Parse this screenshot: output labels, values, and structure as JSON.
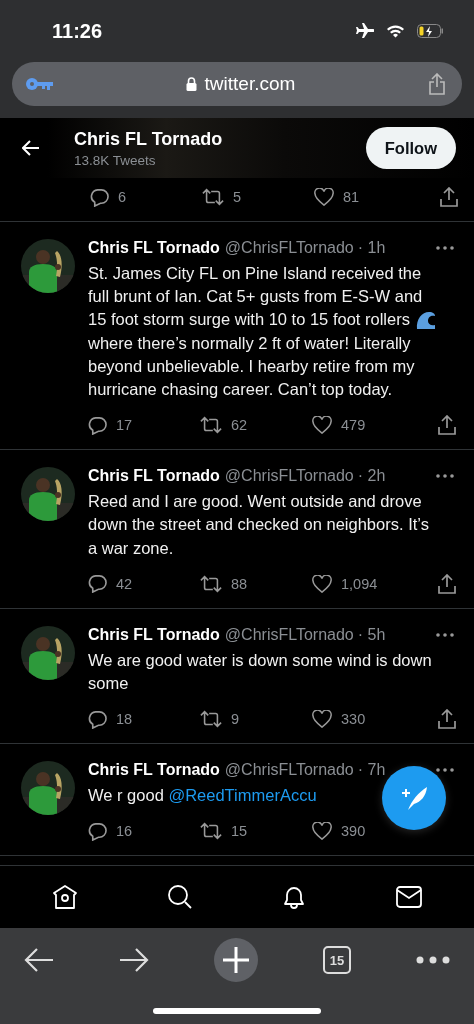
{
  "status_bar": {
    "time": "11:26"
  },
  "address_bar": {
    "url": "twitter.com"
  },
  "profile_header": {
    "name": "Chris FL Tornado",
    "tweet_count": "13.8K Tweets",
    "follow_button": "Follow"
  },
  "previous_tweet": {
    "replies": "6",
    "retweets": "5",
    "likes": "81"
  },
  "tweets": [
    {
      "name": "Chris FL Tornado",
      "handle": "@ChrisFLTornado",
      "time": "· 1h",
      "parts": [
        {
          "kind": "text",
          "text": "St. James City FL on Pine Island received the full brunt of Ian. Cat 5+ gusts from E-S-W and"
        },
        {
          "kind": "text_wave",
          "text": "15 foot storm surge with 10 to 15 foot rollers"
        },
        {
          "kind": "text",
          "text": "where there’s normally 2 ft of water!  Literally beyond unbelievable. I hearby retire from my hurricane chasing career. Can’t top today."
        }
      ],
      "replies": "17",
      "retweets": "62",
      "likes": "479"
    },
    {
      "name": "Chris FL Tornado",
      "handle": "@ChrisFLTornado",
      "time": "· 2h",
      "parts": [
        {
          "kind": "text",
          "text": "Reed and I are good. Went outside and drove down the street and checked on neighbors. It’s a war zone."
        }
      ],
      "replies": "42",
      "retweets": "88",
      "likes": "1,094"
    },
    {
      "name": "Chris FL Tornado",
      "handle": "@ChrisFLTornado",
      "time": "· 5h",
      "parts": [
        {
          "kind": "text",
          "text": "We are good water is down some wind is down some"
        }
      ],
      "replies": "18",
      "retweets": "9",
      "likes": "330"
    },
    {
      "name": "Chris FL Tornado",
      "handle": "@ChrisFLTornado",
      "time": "· 7h",
      "parts": [
        {
          "kind": "text",
          "text": "We r good"
        },
        {
          "kind": "mention",
          "text": "@ReedTimmerAccu"
        }
      ],
      "replies": "16",
      "retweets": "15",
      "likes": "390"
    }
  ],
  "browser_toolbar": {
    "tab_count": "15"
  }
}
